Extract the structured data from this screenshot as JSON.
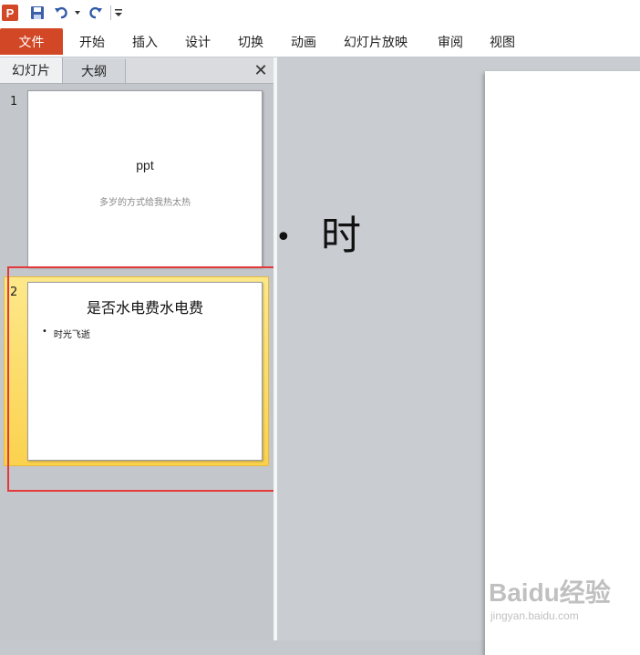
{
  "quick_access": {
    "logo_letter": "P",
    "icons": [
      "powerpoint-logo-icon",
      "save-icon",
      "undo-icon",
      "dropdown-icon",
      "redo-icon",
      "customize-toolbar-icon"
    ]
  },
  "ribbon": {
    "file_tab": "文件",
    "tabs": [
      "开始",
      "插入",
      "设计",
      "切换",
      "动画",
      "幻灯片放映",
      "审阅",
      "视图"
    ]
  },
  "pane": {
    "tabs": [
      "幻灯片",
      "大纲"
    ],
    "close_glyph": "✕"
  },
  "slides": [
    {
      "number": "1",
      "title": "ppt",
      "subtitle": "多岁的方式给我热太热"
    },
    {
      "number": "2",
      "title": "是否水电费水电费",
      "bullet": "时光飞逝"
    }
  ],
  "main_view": {
    "bullet_glyph": "•",
    "visible_text": "时"
  },
  "watermark": {
    "text": "Baidu经验",
    "url": "jingyan.baidu.com"
  },
  "colors": {
    "accent": "#d24726",
    "selection": "#fbd24e",
    "annotation": "#e23a3a"
  }
}
